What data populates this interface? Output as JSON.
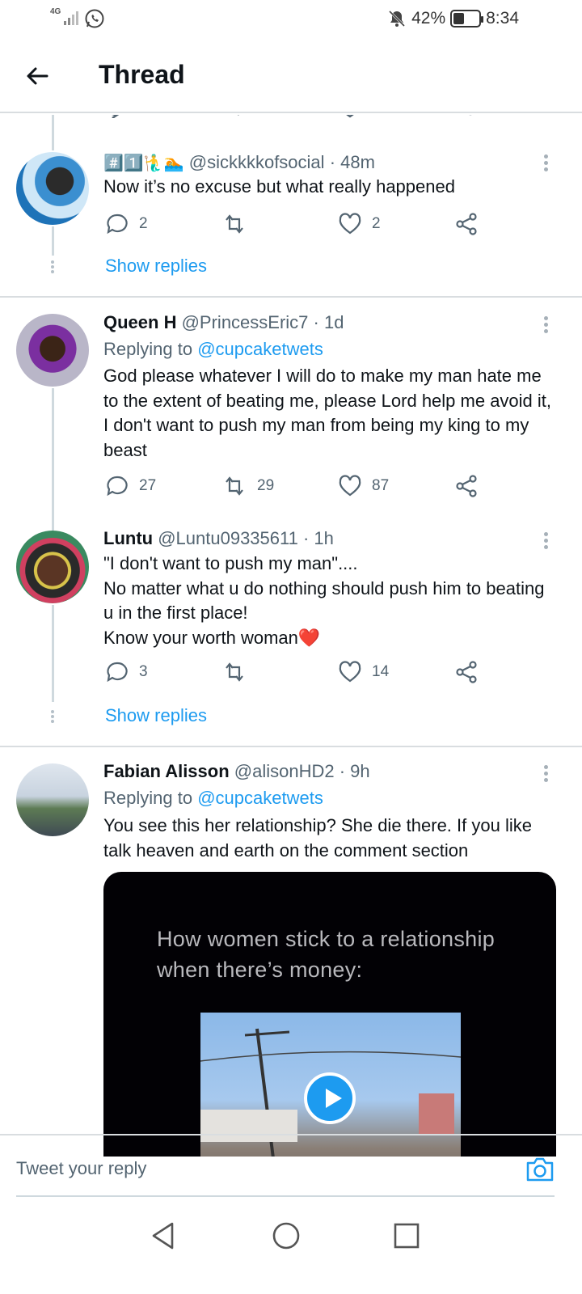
{
  "status_bar": {
    "network": "4G",
    "battery": "42%",
    "battery_level": 0.42,
    "time": "8:34"
  },
  "header": {
    "title": "Thread"
  },
  "tweets": [
    {
      "name": "",
      "emoji_prefix": "#️⃣1️⃣🧜‍♂️🏊",
      "handle": "@sickkkkofsocial",
      "time": "· 48m",
      "text": "Now it’s no excuse but what really happened",
      "replies": "2",
      "retweets": "",
      "likes": "2"
    },
    {
      "name": "Queen H",
      "handle": "@PrincessEric7",
      "time": "· 1d",
      "replying_label": "Replying to",
      "replying_to": "@cupcaketwets",
      "text": "God please whatever I will do to make my man hate me to the extent of beating me, please Lord help me avoid it, I don't want to push my man from being my king to my beast",
      "replies": "27",
      "retweets": "29",
      "likes": "87"
    },
    {
      "name": "Luntu",
      "handle": "@Luntu09335611",
      "time": "· 1h",
      "text": "\"I don't want to push my man\"....\nNo matter what u do nothing should push him to beating u in the first place!\nKnow your worth woman❤️",
      "replies": "3",
      "retweets": "",
      "likes": "14"
    },
    {
      "name": "Fabian Alisson",
      "handle": "@alisonHD2",
      "time": "· 9h",
      "replying_label": "Replying to",
      "replying_to": "@cupcaketwets",
      "text": "You see this her relationship? She die there. If you like talk heaven and earth on the comment section",
      "media_caption": "How women stick to a relationship\nwhen there’s money:"
    }
  ],
  "show_replies_label": "Show replies",
  "composer": {
    "placeholder": "Tweet your reply"
  },
  "icons": {
    "reply": "reply-icon",
    "retweet": "retweet-icon",
    "like": "heart-icon",
    "share": "share-icon",
    "camera": "camera-icon"
  },
  "colors": {
    "accent": "#1d9bf0",
    "text_secondary": "#536471",
    "divider": "#d9dde0"
  }
}
